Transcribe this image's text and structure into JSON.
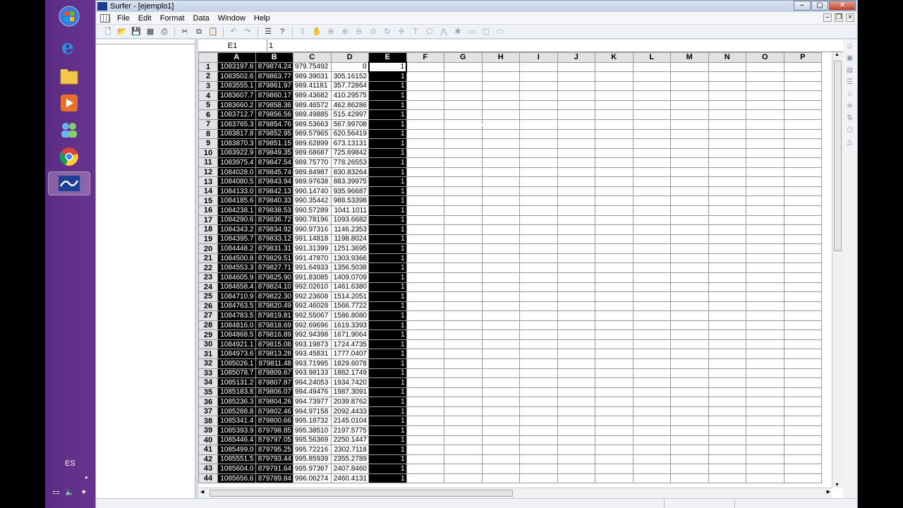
{
  "window": {
    "title": "Surfer - [ejemplo1]"
  },
  "menu": [
    "File",
    "Edit",
    "Format",
    "Data",
    "Window",
    "Help"
  ],
  "taskbar": {
    "language": "ES",
    "icons": [
      "windows-start-icon",
      "internet-explorer-icon",
      "file-explorer-icon",
      "media-player-icon",
      "users-icon",
      "chrome-icon",
      "surfer-icon"
    ]
  },
  "sheet": {
    "cell_ref": "E1",
    "cell_value": "1",
    "columns": [
      "A",
      "B",
      "C",
      "D",
      "E",
      "F",
      "G",
      "H",
      "I",
      "J",
      "K",
      "L",
      "M",
      "N",
      "O",
      "P"
    ],
    "rows": [
      [
        "1083197.6",
        "879874.24",
        "979.75492",
        "0",
        "1"
      ],
      [
        "1083502.6",
        "879863.77",
        "989.39031",
        "305.16152",
        "1"
      ],
      [
        "1083555.1",
        "879861.97",
        "989.41181",
        "357.72864",
        "1"
      ],
      [
        "1083607.7",
        "879860.17",
        "989.43682",
        "410.29575",
        "1"
      ],
      [
        "1083660.2",
        "879858.36",
        "989.46572",
        "462.86286",
        "1"
      ],
      [
        "1083712.7",
        "879856.56",
        "989.49885",
        "515.42997",
        "1"
      ],
      [
        "1083765.3",
        "879854.76",
        "989.53663",
        "567.99708",
        "1"
      ],
      [
        "1083817.8",
        "879852.95",
        "989.57965",
        "620.56419",
        "1"
      ],
      [
        "1083870.3",
        "879851.15",
        "989.62899",
        "673.13131",
        "1"
      ],
      [
        "1083922.9",
        "879849.35",
        "989.68687",
        "725.69842",
        "1"
      ],
      [
        "1083975.4",
        "879847.54",
        "989.75770",
        "778.26553",
        "1"
      ],
      [
        "1084028.0",
        "879845.74",
        "989.84987",
        "830.83264",
        "1"
      ],
      [
        "1084080.5",
        "879843.94",
        "989.97638",
        "883.39975",
        "1"
      ],
      [
        "1084133.0",
        "879842.13",
        "990.14740",
        "935.96687",
        "1"
      ],
      [
        "1084185.6",
        "879840.33",
        "990.35442",
        "988.53398",
        "1"
      ],
      [
        "1084238.1",
        "879838.53",
        "990.57289",
        "1041.1011",
        "1"
      ],
      [
        "1084290.6",
        "879836.72",
        "990.78196",
        "1093.6682",
        "1"
      ],
      [
        "1084343.2",
        "879834.92",
        "990.97316",
        "1146.2353",
        "1"
      ],
      [
        "1084395.7",
        "879833.12",
        "991.14818",
        "1198.8024",
        "1"
      ],
      [
        "1084448.2",
        "879831.31",
        "991.31399",
        "1251.3695",
        "1"
      ],
      [
        "1084500.8",
        "879829.51",
        "991.47870",
        "1303.9366",
        "1"
      ],
      [
        "1084553.3",
        "879827.71",
        "991.64933",
        "1356.5038",
        "1"
      ],
      [
        "1084605.9",
        "879825.90",
        "991.83085",
        "1409.0709",
        "1"
      ],
      [
        "1084658.4",
        "879824.10",
        "992.02610",
        "1461.6380",
        "1"
      ],
      [
        "1084710.9",
        "879822.30",
        "992.23608",
        "1514.2051",
        "1"
      ],
      [
        "1084763.5",
        "879820.49",
        "992.46028",
        "1566.7722",
        "1"
      ],
      [
        "1084783.5",
        "879819.81",
        "992.55067",
        "1586.8080",
        "1"
      ],
      [
        "1084816.0",
        "879818.69",
        "992.69696",
        "1619.3393",
        "1"
      ],
      [
        "1084868.5",
        "879816.89",
        "992.94398",
        "1671.9064",
        "1"
      ],
      [
        "1084921.1",
        "879815.08",
        "993.19873",
        "1724.4735",
        "1"
      ],
      [
        "1084973.6",
        "879813.28",
        "993.45831",
        "1777.0407",
        "1"
      ],
      [
        "1085026.1",
        "879811.48",
        "993.71995",
        "1829.6078",
        "1"
      ],
      [
        "1085078.7",
        "879809.67",
        "993.98133",
        "1882.1749",
        "1"
      ],
      [
        "1085131.2",
        "879807.87",
        "994.24053",
        "1934.7420",
        "1"
      ],
      [
        "1085183.8",
        "879806.07",
        "994.49476",
        "1987.3091",
        "1"
      ],
      [
        "1085236.3",
        "879804.26",
        "994.73977",
        "2039.8762",
        "1"
      ],
      [
        "1085288.8",
        "879802.46",
        "994.97158",
        "2092.4433",
        "1"
      ],
      [
        "1085341.4",
        "879800.66",
        "995.18732",
        "2145.0104",
        "1"
      ],
      [
        "1085393.9",
        "879798.85",
        "995.38510",
        "2197.5775",
        "1"
      ],
      [
        "1085446.4",
        "879797.05",
        "995.56369",
        "2250.1447",
        "1"
      ],
      [
        "1085499.0",
        "879795.25",
        "995.72216",
        "2302.7118",
        "1"
      ],
      [
        "1085551.5",
        "879793.44",
        "995.85939",
        "2355.2789",
        "1"
      ],
      [
        "1085604.0",
        "879791.64",
        "995.97367",
        "2407.8460",
        "1"
      ],
      [
        "1085656.6",
        "879789.84",
        "996.06274",
        "2460.4131",
        "1"
      ]
    ]
  }
}
